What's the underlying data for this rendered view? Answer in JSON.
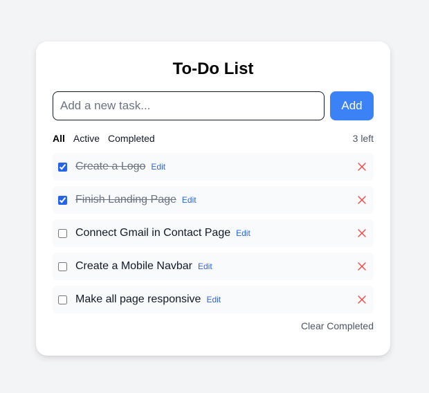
{
  "app": {
    "title": "To-Do List"
  },
  "input": {
    "placeholder": "Add a new task...",
    "value": ""
  },
  "add_button": {
    "label": "Add"
  },
  "filters": [
    {
      "label": "All",
      "selected": true
    },
    {
      "label": "Active",
      "selected": false
    },
    {
      "label": "Completed",
      "selected": false
    }
  ],
  "remaining": "3 left",
  "tasks": [
    {
      "label": "Create a Logo",
      "completed": true,
      "edit_label": "Edit"
    },
    {
      "label": "Finish Landing Page",
      "completed": true,
      "edit_label": "Edit"
    },
    {
      "label": "Connect Gmail in Contact Page",
      "completed": false,
      "edit_label": "Edit"
    },
    {
      "label": "Create a Mobile Navbar",
      "completed": false,
      "edit_label": "Edit"
    },
    {
      "label": "Make all page responsive",
      "completed": false,
      "edit_label": "Edit"
    }
  ],
  "clear_completed": "Clear Completed",
  "colors": {
    "accent": "#3b82f6",
    "edit_link": "#2563eb",
    "delete": "#ef4444",
    "background": "#f3f4f6"
  },
  "icons": {
    "delete": "close-icon"
  }
}
